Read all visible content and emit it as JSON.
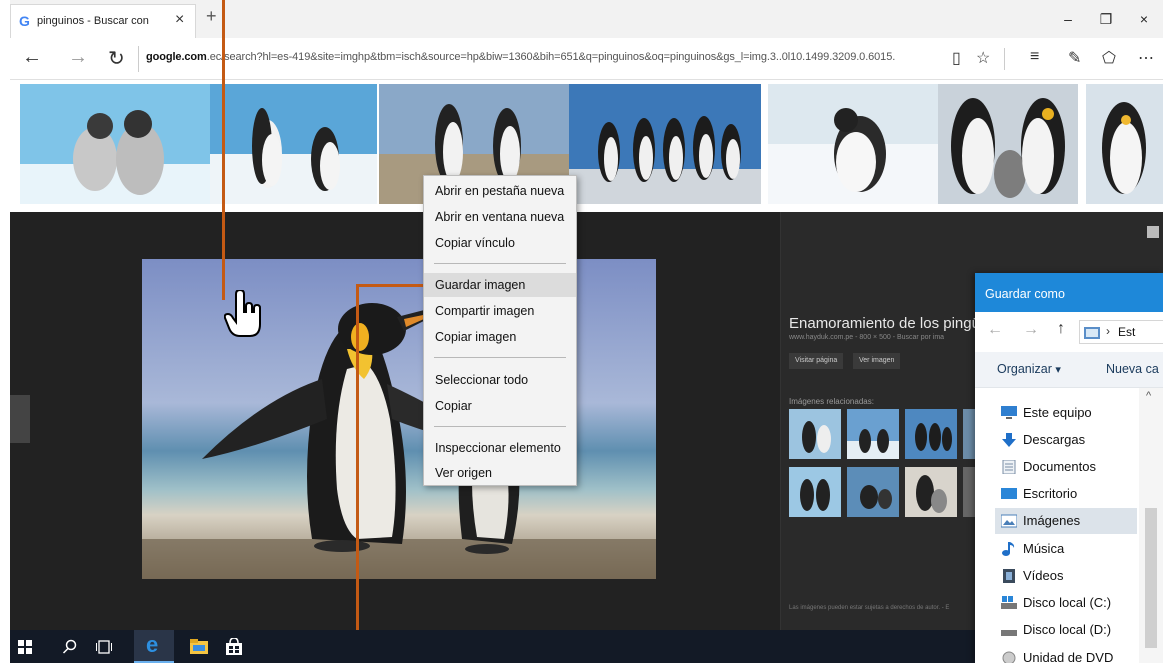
{
  "browser": {
    "tab_title": "pinguinos - Buscar con",
    "tab_favicon": "G",
    "url_host": "google.com",
    "url_rest": ".ec/search?hl=es-419&site=imghp&tbm=isch&source=hp&biw=1360&bih=651&q=pinguinos&oq=pinguinos&gs_l=img.3..0l10.1499.3209.0.6015."
  },
  "icons": {
    "close": "×",
    "new_tab": "+",
    "minimize": "–",
    "restore": "❐",
    "back": "←",
    "forward": "→",
    "refresh": "↻",
    "reading": "▯",
    "favorite": "☆",
    "hub": "≡",
    "note": "✎",
    "share": "⬠",
    "more": "⋯",
    "dropdown": "▾",
    "up": "↑",
    "chevron": "›",
    "scroll_up": "^"
  },
  "preview": {
    "title": "Enamoramiento de los pingüin",
    "subtitle": "www.hayduk.com.pe - 800 × 500 - Buscar por ima",
    "btn_visit": "Visitar página",
    "btn_view": "Ver imagen",
    "related_label": "Imágenes relacionadas:",
    "footer": "Las imágenes pueden estar sujetas a derechos de autor. - E"
  },
  "context_menu": {
    "items": [
      "Abrir en pestaña nueva",
      "Abrir en ventana nueva",
      "Copiar vínculo",
      "Guardar imagen",
      "Compartir imagen",
      "Copiar imagen",
      "Seleccionar todo",
      "Copiar",
      "Inspeccionar elemento",
      "Ver origen"
    ]
  },
  "save_dialog": {
    "title": "Guardar como",
    "path_tail": "Est",
    "organize": "Organizar",
    "new_folder": "Nueva ca",
    "tree": [
      "Este equipo",
      "Descargas",
      "Documentos",
      "Escritorio",
      "Imágenes",
      "Música",
      "Vídeos",
      "Disco local (C:)",
      "Disco local (D:)",
      "Unidad de DVD"
    ]
  },
  "colors": {
    "accent_blue": "#1e88d9",
    "callout_orange": "#c45a14",
    "taskbar": "#131a26"
  }
}
